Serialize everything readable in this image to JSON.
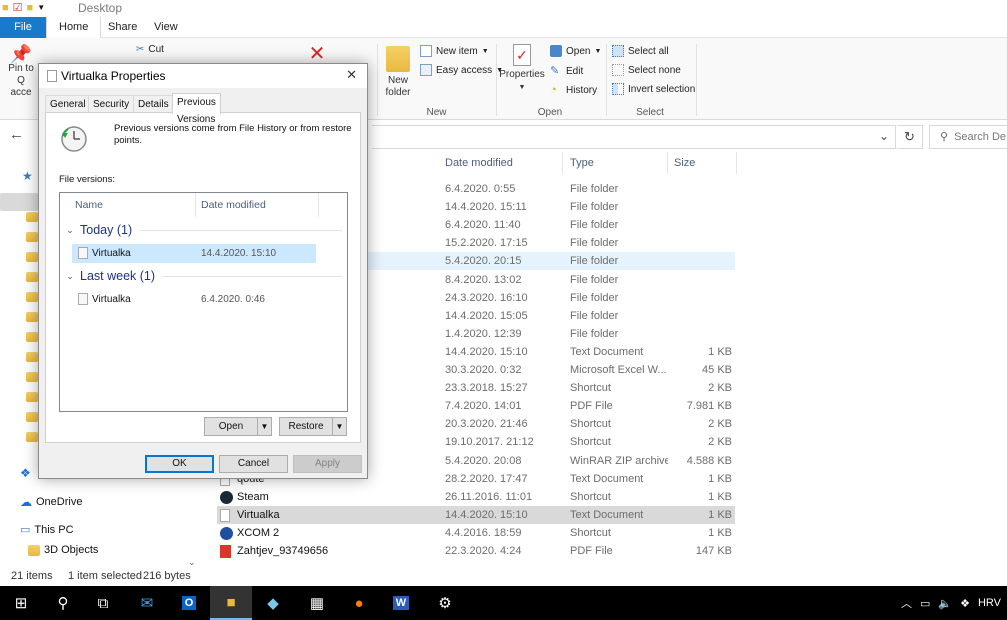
{
  "window": {
    "title": "Desktop"
  },
  "ribbon_tabs": [
    "File",
    "Home",
    "Share",
    "View"
  ],
  "ribbon": {
    "clipboard": {
      "pin_label": "Pin to Q",
      "access_label": "acce",
      "cut_label": "Cut"
    },
    "new": {
      "new_folder_label": "New folder",
      "new_item_label": "New item",
      "easy_access_label": "Easy access",
      "group_label": "New"
    },
    "open": {
      "properties_label": "Properties",
      "open_label": "Open",
      "edit_label": "Edit",
      "history_label": "History",
      "group_label": "Open"
    },
    "select": {
      "select_all_label": "Select all",
      "select_none_label": "Select none",
      "invert_label": "Invert selection",
      "group_label": "Select"
    }
  },
  "search": {
    "placeholder": "Search De"
  },
  "columns": {
    "date": "Date modified",
    "type": "Type",
    "size": "Size"
  },
  "files": [
    {
      "name": "",
      "date": "6.4.2020. 0:55",
      "type": "File folder",
      "size": "",
      "icon": "folder-icon"
    },
    {
      "name": "",
      "date": "14.4.2020. 15:11",
      "type": "File folder",
      "size": "",
      "icon": "folder-icon"
    },
    {
      "name": "",
      "date": "6.4.2020. 11:40",
      "type": "File folder",
      "size": "",
      "icon": "folder-icon"
    },
    {
      "name": "",
      "date": "15.2.2020. 17:15",
      "type": "File folder",
      "size": "",
      "icon": "folder-icon"
    },
    {
      "name": "",
      "date": "5.4.2020. 20:15",
      "type": "File folder",
      "size": "",
      "icon": "folder-icon"
    },
    {
      "name": "",
      "date": "8.4.2020. 13:02",
      "type": "File folder",
      "size": "",
      "icon": "folder-icon"
    },
    {
      "name": "",
      "date": "24.3.2020. 16:10",
      "type": "File folder",
      "size": "",
      "icon": "folder-icon"
    },
    {
      "name": "",
      "date": "14.4.2020. 15:05",
      "type": "File folder",
      "size": "",
      "icon": "folder-icon"
    },
    {
      "name": "",
      "date": "1.4.2020. 12:39",
      "type": "File folder",
      "size": "",
      "icon": "folder-icon"
    },
    {
      "name": "",
      "date": "14.4.2020. 15:10",
      "type": "Text Document",
      "size": "1 KB",
      "icon": "text-file-icon"
    },
    {
      "name": "",
      "date": "30.3.2020. 0:32",
      "type": "Microsoft Excel W...",
      "size": "45 KB",
      "icon": "excel-icon"
    },
    {
      "name": "",
      "date": "23.3.2018. 15:27",
      "type": "Shortcut",
      "size": "2 KB",
      "icon": "shortcut-icon"
    },
    {
      "name": "",
      "date": "7.4.2020. 14:01",
      "type": "PDF File",
      "size": "7.981 KB",
      "icon": "pdf-icon"
    },
    {
      "name": "",
      "date": "20.3.2020. 21:46",
      "type": "Shortcut",
      "size": "2 KB",
      "icon": "shortcut-icon"
    },
    {
      "name": "",
      "date": "19.10.2017. 21:12",
      "type": "Shortcut",
      "size": "2 KB",
      "icon": "shortcut-icon"
    },
    {
      "name": "",
      "date": "5.4.2020. 20:08",
      "type": "WinRAR ZIP archive",
      "size": "4.588 KB",
      "icon": "zip-icon"
    },
    {
      "name": "qoute",
      "date": "28.2.2020. 17:47",
      "type": "Text Document",
      "size": "1 KB",
      "icon": "text-file-icon"
    },
    {
      "name": "Steam",
      "date": "26.11.2016. 11:01",
      "type": "Shortcut",
      "size": "1 KB",
      "icon": "steam-icon"
    },
    {
      "name": "Virtualka",
      "date": "14.4.2020. 15:10",
      "type": "Text Document",
      "size": "1 KB",
      "icon": "text-file-icon"
    },
    {
      "name": "XCOM 2",
      "date": "4.4.2016. 18:59",
      "type": "Shortcut",
      "size": "1 KB",
      "icon": "xcom-icon"
    },
    {
      "name": "Zahtjev_93749656",
      "date": "22.3.2020. 4:24",
      "type": "PDF File",
      "size": "147 KB",
      "icon": "pdf-icon"
    }
  ],
  "nav": {
    "onedrive": "OneDrive",
    "this_pc": "This PC",
    "objects3d": "3D Objects"
  },
  "status": {
    "items": "21 items",
    "selected": "1 item selected",
    "size": "216 bytes"
  },
  "dialog": {
    "title": "Virtualka Properties",
    "tabs": [
      "General",
      "Security",
      "Details",
      "Previous Versions"
    ],
    "info": "Previous versions come from File History or from restore points.",
    "file_versions_label": "File versions:",
    "list_headers": {
      "name": "Name",
      "date": "Date modified"
    },
    "groups": [
      {
        "label": "Today (1)",
        "items": [
          {
            "name": "Virtualka",
            "date": "14.4.2020. 15:10"
          }
        ]
      },
      {
        "label": "Last week (1)",
        "items": [
          {
            "name": "Virtualka",
            "date": "6.4.2020. 0:46"
          }
        ]
      }
    ],
    "open_button": "Open",
    "restore_button": "Restore",
    "ok_button": "OK",
    "cancel_button": "Cancel",
    "apply_button": "Apply"
  },
  "taskbar": {
    "language": "HRV"
  },
  "colors": {
    "accent": "#1979ca",
    "selection": "#cce8ff",
    "selected_row": "#d9d9d9",
    "group_text": "#1e3287"
  }
}
